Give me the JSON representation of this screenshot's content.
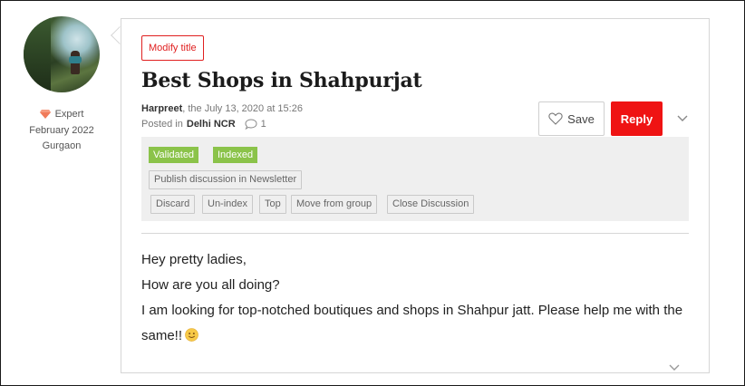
{
  "author": {
    "badge_label": "Expert",
    "joined": "February 2022",
    "location": "Gurgaon"
  },
  "post": {
    "modify_title_label": "Modify title",
    "title": "Best Shops in Shahpurjat",
    "author_name": "Harpreet",
    "date_text": ", the July 13, 2020 at 15:26",
    "posted_in_label": "Posted in",
    "category": "Delhi NCR",
    "comment_count": "1",
    "save_label": "Save",
    "reply_label": "Reply",
    "body_lines": [
      "Hey pretty ladies,",
      "How are you all doing?",
      "I am looking for top-notched boutiques and shops in Shahpur jatt. Please help me with the same!!"
    ]
  },
  "moderation": {
    "tags": [
      "Validated",
      "Indexed"
    ],
    "newsletter_label": "Publish discussion in Newsletter",
    "actions": [
      "Discard",
      "Un-index",
      "Top",
      "Move from group",
      "Close Discussion"
    ]
  },
  "colors": {
    "accent": "#ef1313",
    "tag_green": "#8bc34a",
    "panel_bg": "#efefef"
  },
  "icons": [
    "gem-icon",
    "comment-icon",
    "heart-icon",
    "chevron-down-icon",
    "smiley-icon"
  ]
}
